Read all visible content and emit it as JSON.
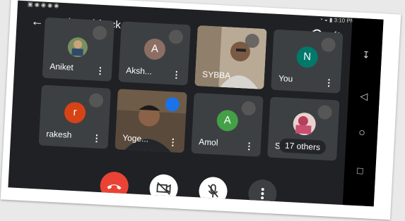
{
  "statusbar": {
    "left": "▣ ◉ ◉ ◉ ◉",
    "right": "◔ ◒ ▮ 3:10 PM"
  },
  "meeting": {
    "code": "vdt-pmkf-yck",
    "back_icon": "arrow-left-icon"
  },
  "participants": [
    {
      "name": "Aniket",
      "type": "photo",
      "muted": true
    },
    {
      "name": "Aksh...",
      "type": "initial",
      "initial": "A",
      "color": "#8d6e63",
      "muted": true
    },
    {
      "name": "SYBBA",
      "type": "video",
      "muted": true
    },
    {
      "name": "You",
      "type": "initial",
      "initial": "N",
      "color": "#00796b",
      "muted": true
    },
    {
      "name": "rakesh",
      "type": "initial",
      "initial": "r",
      "color": "#d84315",
      "muted": true
    },
    {
      "name": "Yoge...",
      "type": "video",
      "speaking": true
    },
    {
      "name": "Amol",
      "type": "initial",
      "initial": "A",
      "color": "#43a047",
      "muted": true
    },
    {
      "name": "S",
      "type": "photo",
      "muted": true,
      "overlay": "17 others"
    }
  ],
  "controls": {
    "end_call": {
      "color": "#ea4335",
      "icon": "end-call-icon"
    },
    "camera": {
      "icon": "camera-off-icon"
    },
    "mic": {
      "icon": "mic-off-icon"
    },
    "more": {
      "icon": "more-vert-icon"
    }
  },
  "navbar": {
    "icons": [
      "keyboard-down-icon",
      "back-triangle-icon",
      "home-circle-icon",
      "recents-square-icon"
    ]
  }
}
